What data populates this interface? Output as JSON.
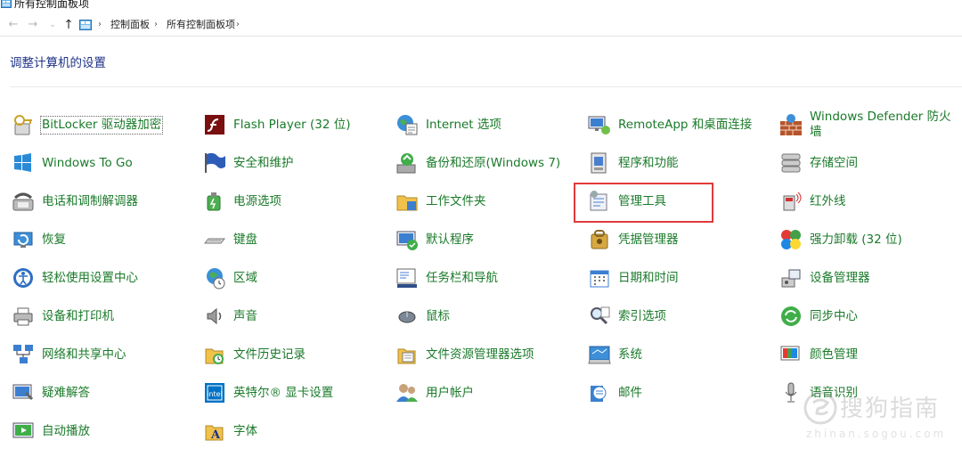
{
  "window": {
    "title": "所有控制面板项"
  },
  "nav": {
    "back_icon": "back-arrow-icon",
    "forward_icon": "forward-arrow-icon",
    "up_icon": "up-arrow-icon",
    "breadcrumbs": [
      "控制面板",
      "所有控制面板项"
    ]
  },
  "heading": "调整计算机的设置",
  "items": [
    {
      "label": "BitLocker 驱动器加密",
      "icon": "bitlocker-icon"
    },
    {
      "label": "Flash Player (32 位)",
      "icon": "flash-icon"
    },
    {
      "label": "Internet 选项",
      "icon": "internet-options-icon"
    },
    {
      "label": "RemoteApp 和桌面连接",
      "icon": "remoteapp-icon"
    },
    {
      "label": "Windows Defender 防火墙",
      "icon": "firewall-icon"
    },
    {
      "label": "Windows To Go",
      "icon": "windows-to-go-icon"
    },
    {
      "label": "安全和维护",
      "icon": "security-flag-icon"
    },
    {
      "label": "备份和还原(Windows 7)",
      "icon": "backup-icon"
    },
    {
      "label": "程序和功能",
      "icon": "programs-icon"
    },
    {
      "label": "存储空间",
      "icon": "storage-icon"
    },
    {
      "label": "电话和调制解调器",
      "icon": "phone-modem-icon"
    },
    {
      "label": "电源选项",
      "icon": "power-icon"
    },
    {
      "label": "工作文件夹",
      "icon": "work-folders-icon"
    },
    {
      "label": "管理工具",
      "icon": "admin-tools-icon"
    },
    {
      "label": "红外线",
      "icon": "infrared-icon"
    },
    {
      "label": "恢复",
      "icon": "recovery-icon"
    },
    {
      "label": "键盘",
      "icon": "keyboard-icon"
    },
    {
      "label": "默认程序",
      "icon": "default-programs-icon"
    },
    {
      "label": "凭据管理器",
      "icon": "credential-icon"
    },
    {
      "label": "强力卸载 (32 位)",
      "icon": "uninstall-icon"
    },
    {
      "label": "轻松使用设置中心",
      "icon": "ease-of-access-icon"
    },
    {
      "label": "区域",
      "icon": "region-icon"
    },
    {
      "label": "任务栏和导航",
      "icon": "taskbar-icon"
    },
    {
      "label": "日期和时间",
      "icon": "calendar-icon"
    },
    {
      "label": "设备管理器",
      "icon": "device-manager-icon"
    },
    {
      "label": "设备和打印机",
      "icon": "printer-icon"
    },
    {
      "label": "声音",
      "icon": "sound-icon"
    },
    {
      "label": "鼠标",
      "icon": "mouse-icon"
    },
    {
      "label": "索引选项",
      "icon": "indexing-icon"
    },
    {
      "label": "同步中心",
      "icon": "sync-icon"
    },
    {
      "label": "网络和共享中心",
      "icon": "network-icon"
    },
    {
      "label": "文件历史记录",
      "icon": "file-history-icon"
    },
    {
      "label": "文件资源管理器选项",
      "icon": "explorer-options-icon"
    },
    {
      "label": "系统",
      "icon": "system-icon"
    },
    {
      "label": "颜色管理",
      "icon": "color-management-icon"
    },
    {
      "label": "疑难解答",
      "icon": "troubleshoot-icon"
    },
    {
      "label": "英特尔® 显卡设置",
      "icon": "intel-graphics-icon"
    },
    {
      "label": "用户帐户",
      "icon": "user-accounts-icon"
    },
    {
      "label": "邮件",
      "icon": "mail-icon"
    },
    {
      "label": "语音识别",
      "icon": "microphone-icon"
    },
    {
      "label": "自动播放",
      "icon": "autoplay-icon"
    },
    {
      "label": "字体",
      "icon": "fonts-icon"
    }
  ],
  "watermark": {
    "text": "搜狗指南",
    "sub": "zhinan.sogou.com"
  }
}
